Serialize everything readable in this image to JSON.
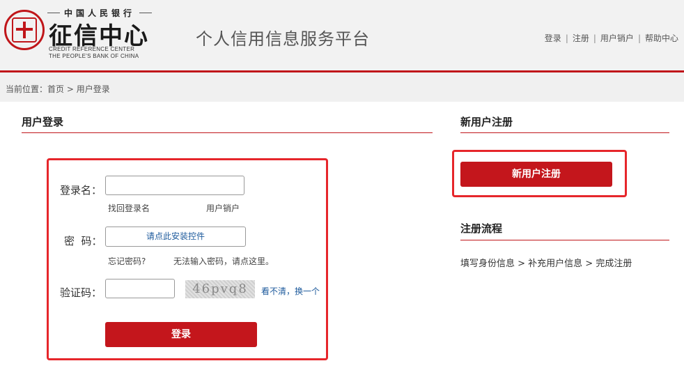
{
  "header": {
    "logo_small": "中国人民银行",
    "logo_main": "征信中心",
    "logo_en_line1": "CREDIT REFERENCE CENTER",
    "logo_en_line2": "THE PEOPLE'S BANK OF CHINA",
    "platform_title": "个人信用信息服务平台",
    "nav": [
      "登录",
      "注册",
      "用户销户",
      "帮助中心"
    ]
  },
  "breadcrumb": {
    "prefix": "当前位置：",
    "home": "首页",
    "separator": " > ",
    "current": "用户登录"
  },
  "login": {
    "title": "用户登录",
    "username_label": "登录名：",
    "username_value": "",
    "retrieve_name": "找回登录名",
    "cancel_account": "用户销户",
    "password_label": "密  码：",
    "password_prompt": "请点此安装控件",
    "forgot_password": "忘记密码?",
    "cannot_input": "无法输入密码，请点这里。",
    "captcha_label": "验证码：",
    "captcha_value": "",
    "captcha_text": "46pvq8",
    "captcha_refresh": "看不清，换一个",
    "submit": "登录"
  },
  "register": {
    "title": "新用户注册",
    "button": "新用户注册",
    "flow_title": "注册流程",
    "flow_text": "填写身份信息 > 补充用户信息 > 完成注册"
  },
  "colors": {
    "brand_red": "#c4161c",
    "highlight_red": "#e6262b",
    "link_blue": "#1d5a9c"
  }
}
